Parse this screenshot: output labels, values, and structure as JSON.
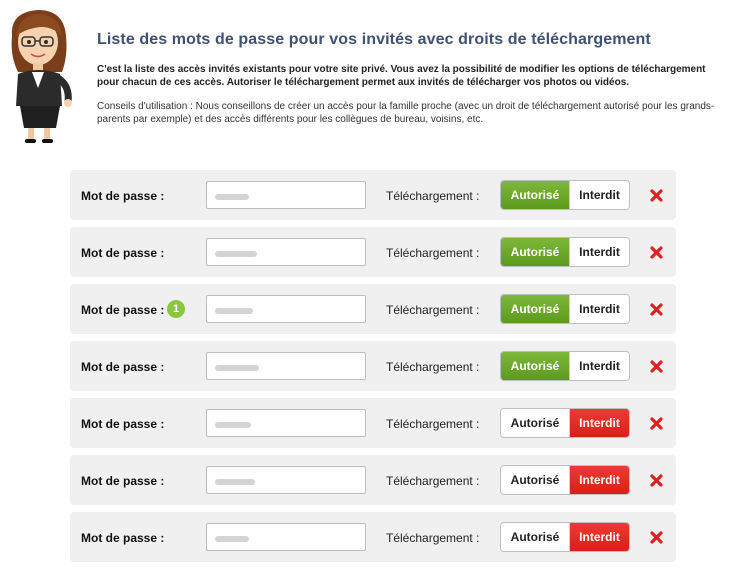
{
  "header": {
    "title": "Liste des mots de passe pour vos invités avec droits de téléchargement",
    "intro": "C'est la liste des accès invités existants pour votre site privé. Vous avez la possibilité de modifier les options de téléchargement pour chacun de ces accès. Autoriser le téléchargement permet aux invités de télécharger vos photos ou vidéos.",
    "tips": "Conseils d'utilisation : Nous conseillons de créer un accès pour la famille proche (avec un droit de téléchargement autorisé pour les grands-parents par exemple) et des accès différents pour les collègues de bureau, voisins, etc."
  },
  "labels": {
    "password": "Mot de passe :",
    "download": "Téléchargement :",
    "authorized": "Autorisé",
    "forbidden": "Interdit"
  },
  "badge": "1",
  "rows": [
    {
      "download": "authorized"
    },
    {
      "download": "authorized"
    },
    {
      "download": "authorized",
      "badge": true
    },
    {
      "download": "authorized"
    },
    {
      "download": "forbidden"
    },
    {
      "download": "forbidden"
    },
    {
      "download": "forbidden"
    }
  ],
  "colors": {
    "title": "#3f5174",
    "authorized_active": "#6aa82b",
    "forbidden_active": "#e12b25",
    "row_bg": "#f0f0f0",
    "delete_icon": "#e02020"
  },
  "icons": {
    "delete": "close-icon"
  }
}
